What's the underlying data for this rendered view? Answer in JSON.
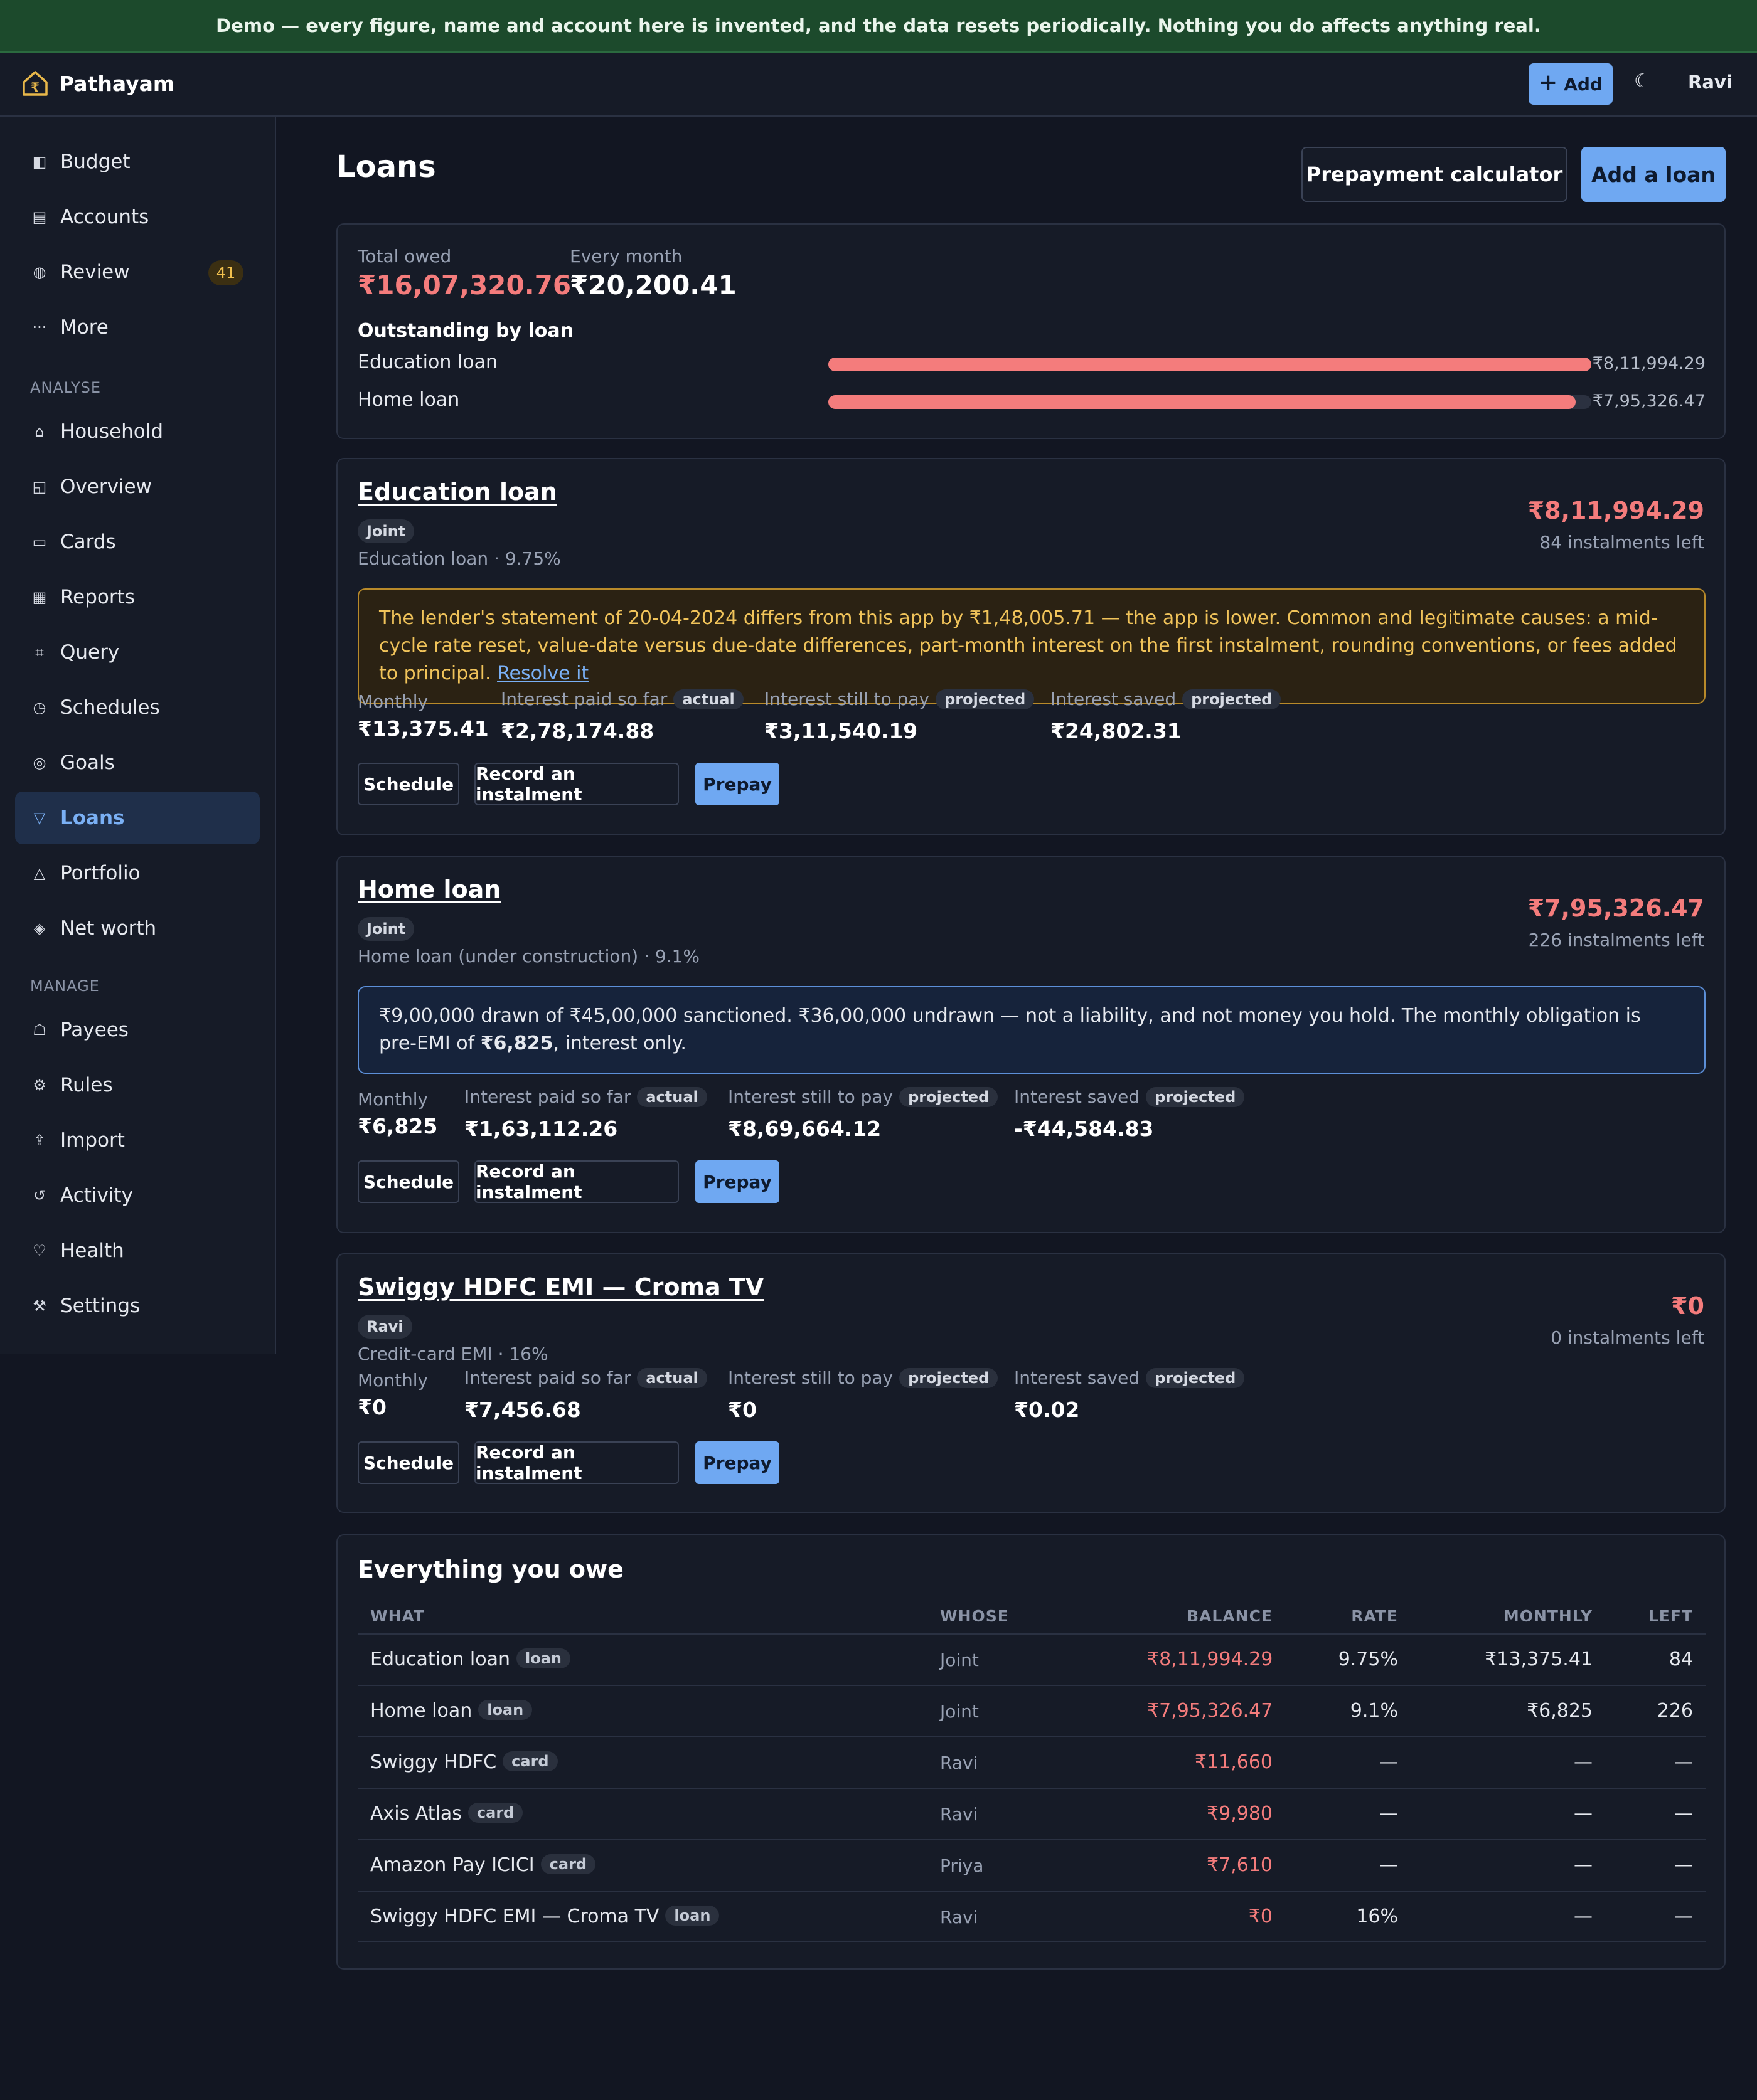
{
  "banner": "Demo — every figure, name and account here is invented, and the data resets periodically. Nothing you do affects anything real.",
  "app": {
    "name": "Pathayam",
    "add_label": "Add",
    "theme_icon": "☾",
    "user": "Ravi"
  },
  "sidebar": {
    "primary": [
      {
        "label": "Budget",
        "icon": "◧"
      },
      {
        "label": "Accounts",
        "icon": "▤"
      },
      {
        "label": "Review",
        "icon": "◍",
        "badge": "41"
      },
      {
        "label": "More",
        "icon": "···"
      }
    ],
    "analyse_heading": "ANALYSE",
    "analyse": [
      {
        "label": "Household",
        "icon": "⌂"
      },
      {
        "label": "Overview",
        "icon": "◱"
      },
      {
        "label": "Cards",
        "icon": "▭"
      },
      {
        "label": "Reports",
        "icon": "▦"
      },
      {
        "label": "Query",
        "icon": "⌗"
      },
      {
        "label": "Schedules",
        "icon": "◷"
      },
      {
        "label": "Goals",
        "icon": "◎"
      },
      {
        "label": "Loans",
        "icon": "▽",
        "active": true
      },
      {
        "label": "Portfolio",
        "icon": "△"
      },
      {
        "label": "Net worth",
        "icon": "◈"
      }
    ],
    "manage_heading": "MANAGE",
    "manage": [
      {
        "label": "Payees",
        "icon": "☖"
      },
      {
        "label": "Rules",
        "icon": "⚙"
      },
      {
        "label": "Import",
        "icon": "⇪"
      },
      {
        "label": "Activity",
        "icon": "↺"
      },
      {
        "label": "Health",
        "icon": "♡"
      },
      {
        "label": "Settings",
        "icon": "⚒"
      }
    ]
  },
  "page": {
    "title": "Loans",
    "prepay_calc": "Prepayment calculator",
    "add_loan": "Add a loan"
  },
  "summary": {
    "total_owed_label": "Total owed",
    "total_owed": "₹16,07,320.76",
    "every_month_label": "Every month",
    "every_month": "₹20,200.41",
    "outstanding_heading": "Outstanding by loan",
    "bars": [
      {
        "name": "Education loan",
        "value": "₹8,11,994.29",
        "fraction": 1.0
      },
      {
        "name": "Home loan",
        "value": "₹7,95,326.47",
        "fraction": 0.9795
      }
    ]
  },
  "stat_labels": {
    "monthly": "Monthly",
    "interest_paid": "Interest paid so far",
    "interest_to_pay": "Interest still to pay",
    "interest_saved": "Interest saved",
    "actual": "actual",
    "projected": "projected"
  },
  "buttons": {
    "schedule": "Schedule",
    "record": "Record an instalment",
    "prepay": "Prepay"
  },
  "loans": [
    {
      "name": "Education loan",
      "owner": "Joint",
      "sub": "Education loan · 9.75%",
      "balance": "₹8,11,994.29",
      "left": "84 instalments left",
      "warning": "The lender's statement of 20-04-2024 differs from this app by ₹1,48,005.71 — the app is lower. Common and legitimate causes: a mid-cycle rate reset, value-date versus due-date differences, part-month interest on the first instalment, rounding conventions, or fees added to principal.",
      "warning_link": "Resolve it",
      "monthly": "₹13,375.41",
      "interest_paid": "₹2,78,174.88",
      "interest_to_pay": "₹3,11,540.19",
      "interest_saved": "₹24,802.31"
    },
    {
      "name": "Home loan",
      "owner": "Joint",
      "sub": "Home loan (under construction) · 9.1%",
      "balance": "₹7,95,326.47",
      "left": "226 instalments left",
      "info_pre": "₹9,00,000 drawn of ₹45,00,000 sanctioned. ₹36,00,000 undrawn — not a liability, and not money you hold. The monthly obligation is pre-EMI of ",
      "info_bold": "₹6,825",
      "info_post": ", interest only.",
      "monthly": "₹6,825",
      "interest_paid": "₹1,63,112.26",
      "interest_to_pay": "₹8,69,664.12",
      "interest_saved": "-₹44,584.83"
    },
    {
      "name": "Swiggy HDFC EMI — Croma TV",
      "owner": "Ravi",
      "sub": "Credit-card EMI · 16%",
      "balance": "₹0",
      "left": "0 instalments left",
      "monthly": "₹0",
      "interest_paid": "₹7,456.68",
      "interest_to_pay": "₹0",
      "interest_saved": "₹0.02"
    }
  ],
  "owe_table": {
    "title": "Everything you owe",
    "headers": [
      "WHAT",
      "WHOSE",
      "BALANCE",
      "RATE",
      "MONTHLY",
      "LEFT"
    ],
    "rows": [
      {
        "what": "Education loan",
        "kind": "loan",
        "whose": "Joint",
        "balance": "₹8,11,994.29",
        "rate": "9.75%",
        "monthly": "₹13,375.41",
        "left": "84"
      },
      {
        "what": "Home loan",
        "kind": "loan",
        "whose": "Joint",
        "balance": "₹7,95,326.47",
        "rate": "9.1%",
        "monthly": "₹6,825",
        "left": "226"
      },
      {
        "what": "Swiggy HDFC",
        "kind": "card",
        "whose": "Ravi",
        "balance": "₹11,660",
        "rate": "—",
        "monthly": "—",
        "left": "—"
      },
      {
        "what": "Axis Atlas",
        "kind": "card",
        "whose": "Ravi",
        "balance": "₹9,980",
        "rate": "—",
        "monthly": "—",
        "left": "—"
      },
      {
        "what": "Amazon Pay ICICI",
        "kind": "card",
        "whose": "Priya",
        "balance": "₹7,610",
        "rate": "—",
        "monthly": "—",
        "left": "—"
      },
      {
        "what": "Swiggy HDFC EMI — Croma TV",
        "kind": "loan",
        "whose": "Ravi",
        "balance": "₹0",
        "rate": "16%",
        "monthly": "—",
        "left": "—"
      }
    ]
  }
}
